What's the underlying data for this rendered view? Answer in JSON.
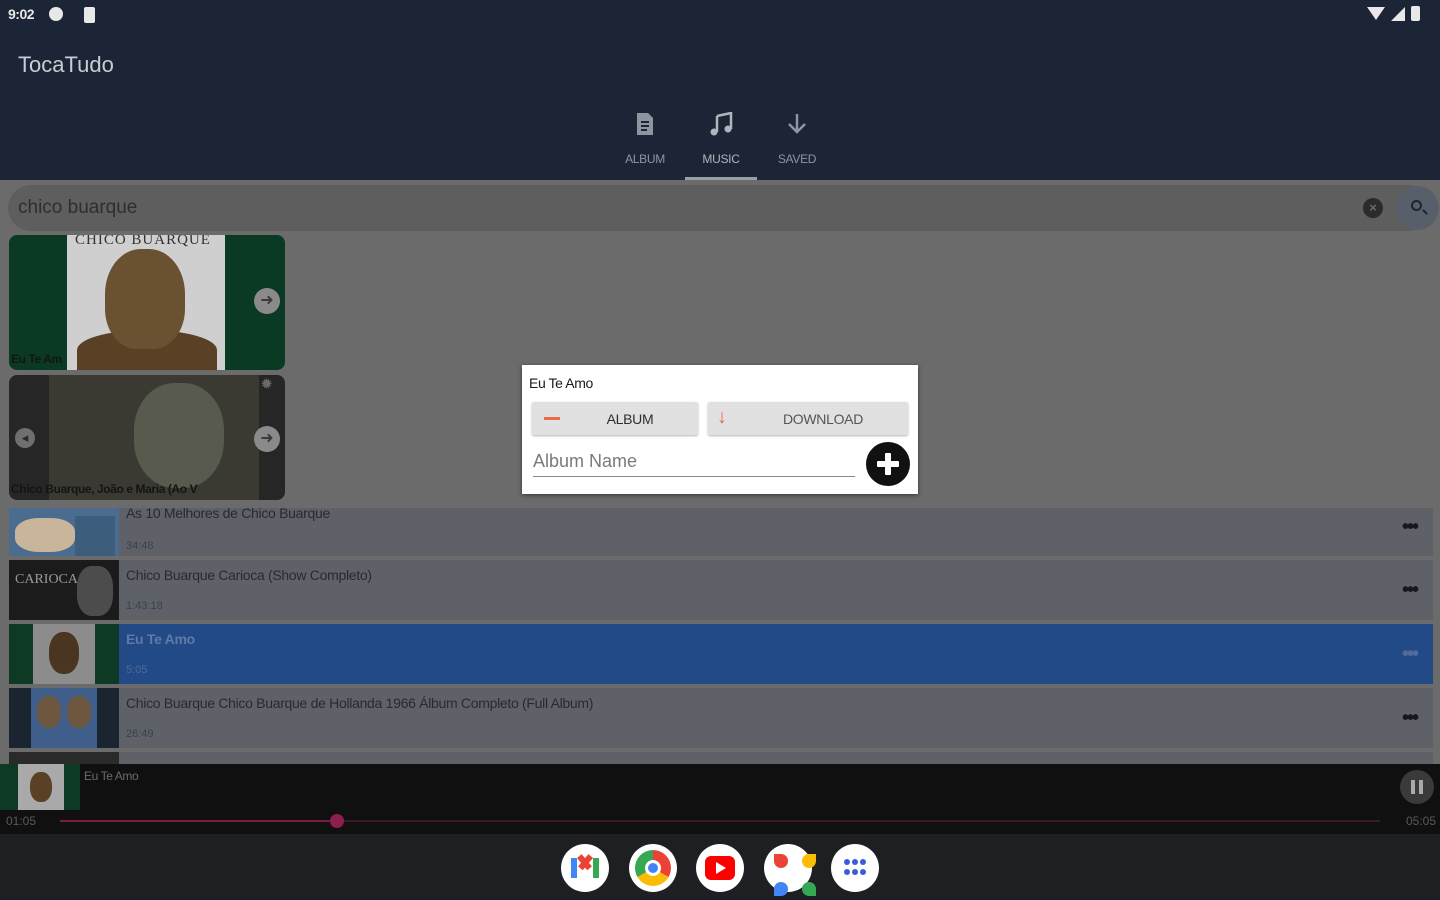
{
  "status_bar": {
    "time": "9:02"
  },
  "app": {
    "title": "TocaTudo"
  },
  "tabs": [
    {
      "label": "ALBUM",
      "icon": "album-file-icon",
      "active": false
    },
    {
      "label": "MUSIC",
      "icon": "music-note-icon",
      "active": true
    },
    {
      "label": "SAVED",
      "icon": "download-arrow-icon",
      "active": false
    }
  ],
  "search": {
    "value": "chico buarque"
  },
  "album_cards": [
    {
      "art_text": "CHICO BUARQUE",
      "caption": "Eu Te Am"
    },
    {
      "caption": "Chico Buarque, João e Maria (Ao V"
    }
  ],
  "results": [
    {
      "title": "As 10 Melhores de Chico Buarque",
      "duration": "34:48",
      "selected": false
    },
    {
      "title": "Chico Buarque  Carioca (Show Completo)",
      "duration": "1:43:18",
      "selected": false
    },
    {
      "title": "Eu Te Amo",
      "duration": "5:05",
      "selected": true
    },
    {
      "title": "Chico Buarque  Chico Buarque de Hollanda 1966  Álbum Completo (Full Album)",
      "duration": "26:49",
      "selected": false
    }
  ],
  "dialog": {
    "title": "Eu Te Amo",
    "album_button": "ALBUM",
    "download_button": "DOWNLOAD",
    "album_name_placeholder": "Album Name"
  },
  "player": {
    "title": "Eu Te Amo",
    "elapsed": "01:05",
    "total": "05:05",
    "progress": 0.21
  },
  "taskbar": [
    "Gmail",
    "Chrome",
    "YouTube",
    "Photos",
    "All apps"
  ]
}
